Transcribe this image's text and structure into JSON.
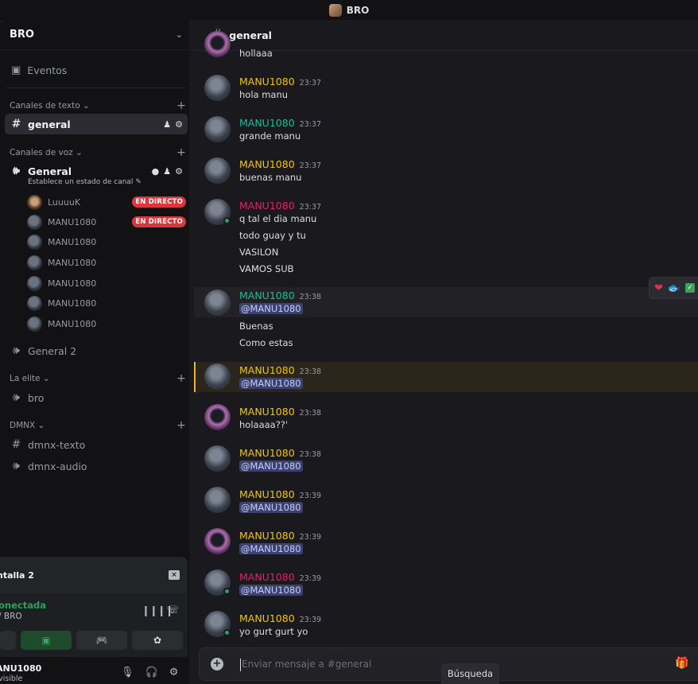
{
  "titlebar": {
    "title": "BRO"
  },
  "server": {
    "name": "BRO",
    "events_label": "Eventos",
    "categories": {
      "text": "Canales de texto",
      "voice": "Canales de voz",
      "elite": "La elite",
      "dmnx": "DMNX"
    },
    "channels": {
      "general_text": "general",
      "general_voice": "General",
      "general_voice_status": "Establece un estado de canal",
      "general2": "General 2",
      "bro": "bro",
      "dmnx_texto": "dmnx-texto",
      "dmnx_audio": "dmnx-audio"
    },
    "voice_users": [
      {
        "name": "LuuuuK",
        "live": "EN DIRECTO"
      },
      {
        "name": "MANU1080",
        "live": "EN DIRECTO"
      },
      {
        "name": "MANU1080",
        "live": ""
      },
      {
        "name": "MANU1080",
        "live": ""
      },
      {
        "name": "MANU1080",
        "live": ""
      },
      {
        "name": "MANU1080",
        "live": ""
      },
      {
        "name": "MANU1080",
        "live": ""
      }
    ]
  },
  "voice_panel": {
    "stream_title": "ntalla 2",
    "connection": "onectada",
    "location": "/ BRO"
  },
  "user_panel": {
    "username": "ANU1080",
    "status": "visible"
  },
  "chat": {
    "channel_name": "general",
    "messages": [
      {
        "partial": "hollaaa"
      },
      {
        "author": "MANU1080",
        "time": "23:37",
        "lines": [
          "hola manu"
        ]
      },
      {
        "author": "MANU1080",
        "time": "23:37",
        "lines": [
          "grande manu"
        ]
      },
      {
        "author": "MANU1080",
        "time": "23:37",
        "lines": [
          "buenas manu"
        ]
      },
      {
        "author": "MANU1080",
        "time": "23:37",
        "lines": [
          "q tal el dia manu",
          "todo guay y tu",
          "VASILON",
          "VAMOS SUB"
        ]
      },
      {
        "author": "MANU1080",
        "time": "23:38",
        "lines": [
          "@MANU1080",
          "Buenas",
          "Como estas"
        ]
      },
      {
        "author": "MANU1080",
        "time": "23:38",
        "lines": [
          "@MANU1080"
        ]
      },
      {
        "author": "MANU1080",
        "time": "23:38",
        "lines": [
          "holaaaa??'"
        ]
      },
      {
        "author": "MANU1080",
        "time": "23:38",
        "lines": [
          "@MANU1080"
        ]
      },
      {
        "author": "MANU1080",
        "time": "23:39",
        "lines": [
          "@MANU1080"
        ]
      },
      {
        "author": "MANU1080",
        "time": "23:39",
        "lines": [
          "@MANU1080"
        ]
      },
      {
        "author": "MANU1080",
        "time": "23:39",
        "lines": [
          "@MANU1080"
        ]
      },
      {
        "author": "MANU1080",
        "time": "23:39",
        "lines": [
          "yo gurt gurt yo"
        ]
      }
    ],
    "composer_placeholder": "Enviar mensaje a #general",
    "tooltip": "Búsqueda"
  },
  "colors": {
    "role_yellow": "#f1c40f",
    "role_teal": "#1abc9c",
    "role_pink": "#e91e63",
    "live_red": "#da373c",
    "online_green": "#23a55a",
    "mention_bg": "#3c4270"
  }
}
